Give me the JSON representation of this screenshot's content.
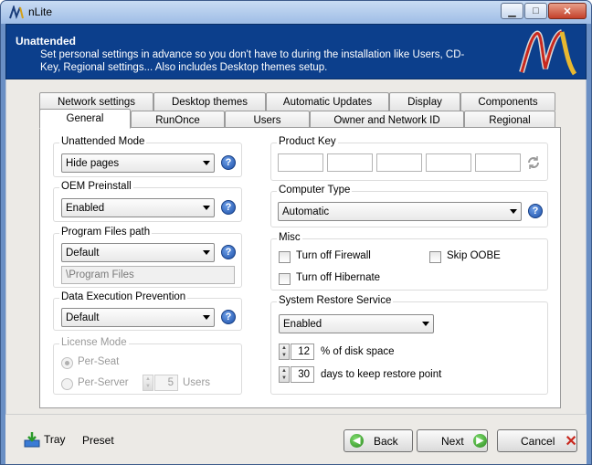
{
  "window": {
    "title": "nLite"
  },
  "header": {
    "title": "Unattended",
    "description": "Set personal settings in advance so you don't have to during the installation like Users, CD-Key, Regional settings... Also includes Desktop themes setup."
  },
  "tabs_row1": [
    "Network settings",
    "Desktop themes",
    "Automatic Updates",
    "Display",
    "Components"
  ],
  "tabs_row2": [
    "General",
    "RunOnce",
    "Users",
    "Owner and Network ID",
    "Regional"
  ],
  "active_tab": "General",
  "left": {
    "unattended_mode": {
      "label": "Unattended Mode",
      "value": "Hide pages"
    },
    "oem_preinstall": {
      "label": "OEM Preinstall",
      "value": "Enabled"
    },
    "program_files": {
      "label": "Program Files path",
      "value": "Default",
      "path_placeholder": "\\Program Files"
    },
    "dep": {
      "label": "Data Execution Prevention",
      "value": "Default"
    },
    "license": {
      "label": "License Mode",
      "per_seat": "Per-Seat",
      "per_server": "Per-Server",
      "users_count": "5",
      "users_label": "Users"
    }
  },
  "right": {
    "product_key": {
      "label": "Product Key"
    },
    "computer_type": {
      "label": "Computer Type",
      "value": "Automatic"
    },
    "misc": {
      "label": "Misc",
      "firewall": "Turn off Firewall",
      "skip_oobe": "Skip OOBE",
      "hibernate": "Turn off Hibernate"
    },
    "restore": {
      "label": "System Restore Service",
      "value": "Enabled",
      "disk_pct": "12",
      "disk_label": "% of disk space",
      "days": "30",
      "days_label": "days to keep restore point"
    }
  },
  "bottom": {
    "tray": "Tray",
    "preset": "Preset",
    "back": "Back",
    "next": "Next",
    "cancel": "Cancel"
  },
  "colors": {
    "header_bg": "#0c3f8c",
    "frame": "#6a8fc4",
    "panel_bg": "#eceae6"
  }
}
